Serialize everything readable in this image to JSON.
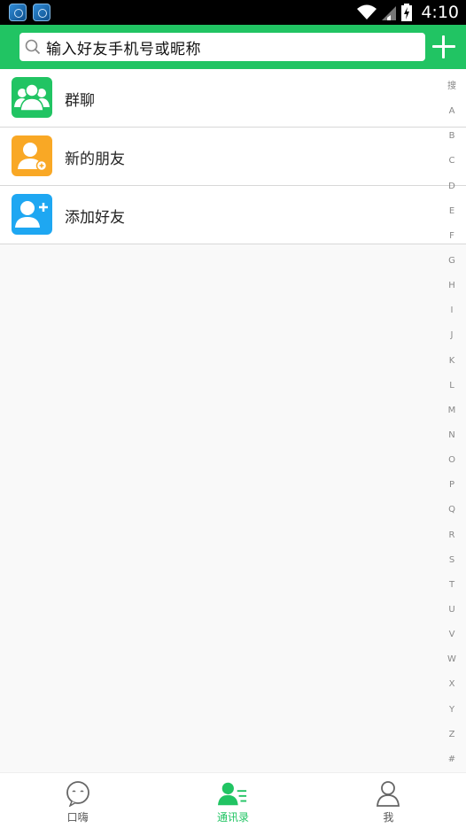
{
  "status_bar": {
    "time": "4:10",
    "icons": [
      "app-notification-icon",
      "app-notification-icon",
      "wifi-icon",
      "signal-icon",
      "battery-charging-icon"
    ]
  },
  "header": {
    "search": {
      "placeholder": "输入好友手机号或昵称",
      "icon": "search-icon"
    },
    "add_icon": "plus-icon",
    "background": "#21c463"
  },
  "list": {
    "items": [
      {
        "label": "群聊",
        "icon": "group-chat-icon",
        "color": "#21c463"
      },
      {
        "label": "新的朋友",
        "icon": "new-friend-icon",
        "color": "#f9a825"
      },
      {
        "label": "添加好友",
        "icon": "add-friend-icon",
        "color": "#1ea7f2"
      }
    ]
  },
  "index_bar": {
    "letters": [
      "搜",
      "A",
      "B",
      "C",
      "D",
      "E",
      "F",
      "G",
      "H",
      "I",
      "J",
      "K",
      "L",
      "M",
      "N",
      "O",
      "P",
      "Q",
      "R",
      "S",
      "T",
      "U",
      "V",
      "W",
      "X",
      "Y",
      "Z",
      "#"
    ]
  },
  "bottom_nav": {
    "tabs": [
      {
        "label": "口嗨",
        "icon": "chat-bubble-icon",
        "active": false
      },
      {
        "label": "通讯录",
        "icon": "contacts-icon",
        "active": true
      },
      {
        "label": "我",
        "icon": "profile-icon",
        "active": false
      }
    ],
    "accent": "#21c463"
  }
}
